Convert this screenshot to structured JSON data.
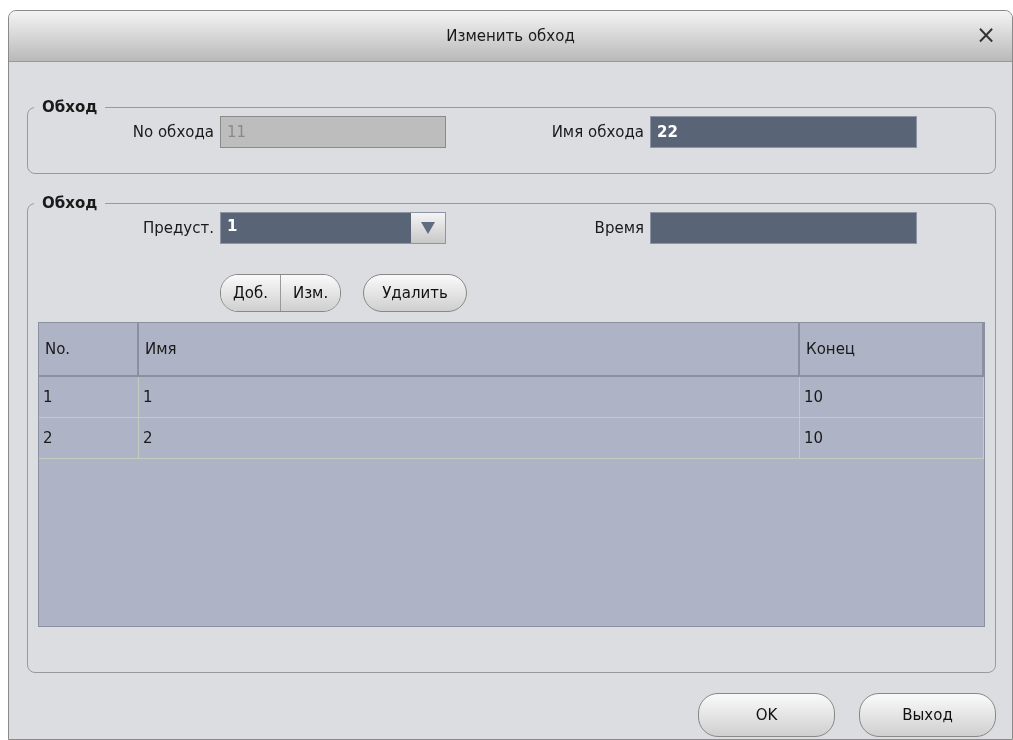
{
  "window": {
    "title": "Изменить обход",
    "close": "×"
  },
  "route": {
    "legend": "Обход",
    "number_label": "No обхода",
    "number": {
      "value": "11",
      "disabled": true
    },
    "name_label": "Имя обхода",
    "name": {
      "value": "22",
      "disabled": false
    }
  },
  "points": {
    "legend": "Обход",
    "preset_label": "Предуст.",
    "preset": {
      "value": "1",
      "disabled": false
    },
    "time_label": "Время",
    "time": {
      "disabled": false
    },
    "segment_buttons": [
      "Доб.",
      "Изм."
    ],
    "delete_button": "Удалить",
    "table": {
      "columns": [
        "No.",
        "Имя",
        "Конец"
      ],
      "rows": [
        [
          "1",
          "1",
          "10"
        ],
        [
          "2",
          "2",
          "10"
        ]
      ]
    }
  },
  "buttons": [
    "OK",
    "Выход"
  ]
}
